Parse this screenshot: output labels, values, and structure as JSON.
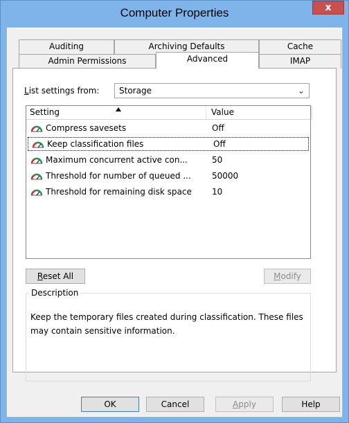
{
  "window": {
    "title": "Computer Properties",
    "close_label": "x"
  },
  "tabs": {
    "row1": [
      "Auditing",
      "Archiving Defaults",
      "Cache"
    ],
    "row2": [
      "Admin Permissions",
      "Advanced",
      "IMAP"
    ],
    "active": "Advanced"
  },
  "list_settings": {
    "label": "List settings from:",
    "selected": "Storage",
    "arrow": "⌄"
  },
  "table": {
    "columns": [
      "Setting",
      "Value"
    ],
    "sort_column": "Setting",
    "sort_direction": "ascending",
    "rows": [
      {
        "setting": "Compress savesets",
        "value": "Off"
      },
      {
        "setting": "Keep classification files",
        "value": "Off"
      },
      {
        "setting": "Maximum concurrent active con...",
        "value": "50"
      },
      {
        "setting": "Threshold for number of queued ...",
        "value": "50000"
      },
      {
        "setting": "Threshold for remaining disk space",
        "value": "10"
      }
    ],
    "selected_row": 1,
    "row_icon": "gauge-icon"
  },
  "buttons": {
    "reset_all": "Reset All",
    "modify": "Modify",
    "ok": "OK",
    "cancel": "Cancel",
    "apply": "Apply",
    "help": "Help"
  },
  "description": {
    "title": "Description",
    "text": "Keep the temporary files created during classification. These files may contain sensitive information."
  },
  "colors": {
    "title_bar": "#7eb4ea",
    "close_button": "#c75050"
  }
}
